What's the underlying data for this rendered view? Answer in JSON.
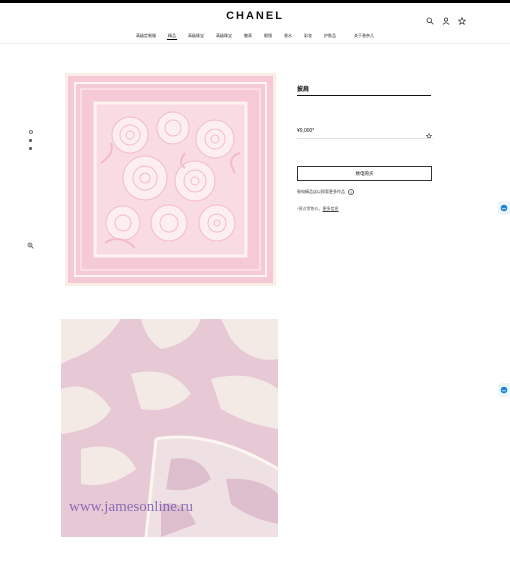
{
  "header": {
    "logo": "CHANEL",
    "icons": [
      "search-icon",
      "user-icon",
      "star-icon"
    ]
  },
  "nav": {
    "items": [
      "高级定制服",
      "精品",
      "高级珠宝",
      "高级珠宝",
      "腕表",
      "眼镜",
      "香水",
      "彩妆",
      "护肤品",
      "关于香奈儿"
    ],
    "active_index": 1
  },
  "gallery": {
    "watermark": "www.jamesonline.ru"
  },
  "product": {
    "title": "披肩",
    "price": "¥9,000*",
    "buy_label": "致电购买",
    "store_link": "致电精品店以探索更多作品",
    "store_info_icon": "?",
    "note": "*建议零售价。",
    "note_link": "更多信息"
  },
  "colors": {
    "scarf_pink": "#f6c9d6",
    "scarf_cream": "#fbf0ea",
    "accent_blue": "#1b82d6"
  }
}
